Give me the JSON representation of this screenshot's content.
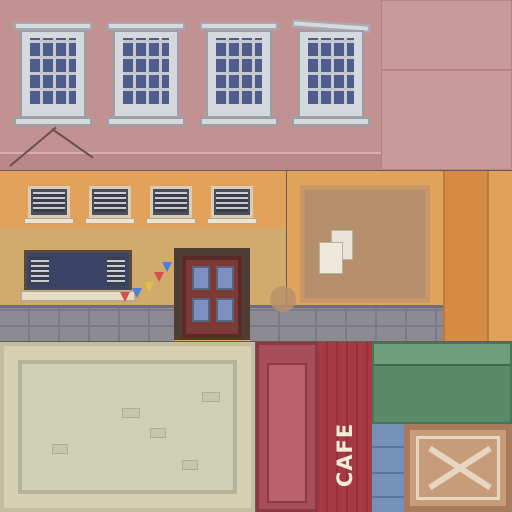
{
  "texture_atlas": {
    "sections": {
      "top_facade": {
        "wall_color": "#c29293",
        "window_count": 4
      },
      "middle_facade": {
        "wall_color": "#e2a25c",
        "small_window_count": 4
      },
      "notice_board": {
        "paper_count": 2
      },
      "sign_panel": {
        "color": "#d6d1b2"
      },
      "red_door": {
        "color": "#a84e58"
      },
      "cafe_sign": {
        "text": "CAFE",
        "text_color": "#f4ecd8",
        "background": "#a63a43"
      },
      "green_awning": {
        "color": "#5a8a68"
      },
      "crate": {
        "color": "#c79c79"
      }
    },
    "colors": {
      "window_glass": "#4d5c8a",
      "door": "#7b3a36",
      "cobblestone": "#8c8a93",
      "blue_wall": "#7792b8"
    }
  }
}
